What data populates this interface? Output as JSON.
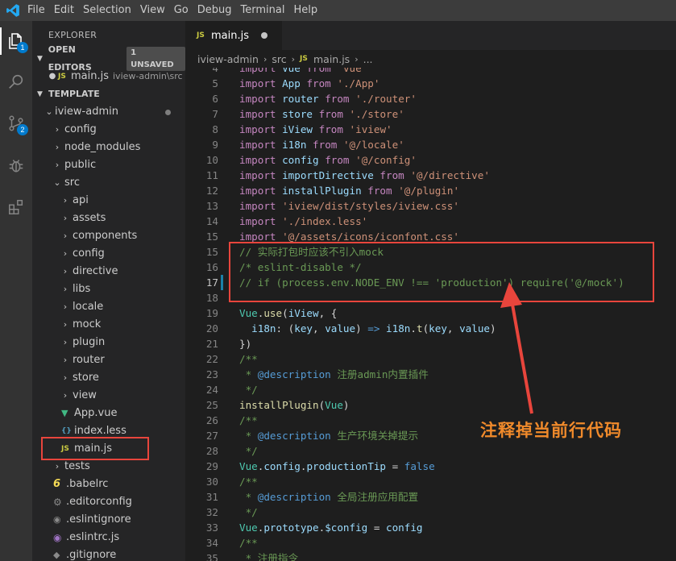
{
  "menubar": {
    "items": [
      "File",
      "Edit",
      "Selection",
      "View",
      "Go",
      "Debug",
      "Terminal",
      "Help"
    ]
  },
  "activitybar": {
    "explorer_badge": "1",
    "scm_badge": "2"
  },
  "sidebar": {
    "title": "EXPLORER",
    "open_editors": {
      "label": "OPEN EDITORS",
      "badge": "1 UNSAVED",
      "files": [
        {
          "name": "main.js",
          "path": "iview-admin\\src"
        }
      ]
    },
    "workspace": {
      "label": "TEMPLATE",
      "root": "iview-admin",
      "items": [
        {
          "name": "config",
          "type": "folder",
          "depth": 1
        },
        {
          "name": "node_modules",
          "type": "folder",
          "depth": 1
        },
        {
          "name": "public",
          "type": "folder",
          "depth": 1
        },
        {
          "name": "src",
          "type": "folder-open",
          "depth": 1
        },
        {
          "name": "api",
          "type": "folder",
          "depth": 2
        },
        {
          "name": "assets",
          "type": "folder",
          "depth": 2
        },
        {
          "name": "components",
          "type": "folder",
          "depth": 2
        },
        {
          "name": "config",
          "type": "folder",
          "depth": 2
        },
        {
          "name": "directive",
          "type": "folder",
          "depth": 2
        },
        {
          "name": "libs",
          "type": "folder",
          "depth": 2
        },
        {
          "name": "locale",
          "type": "folder",
          "depth": 2
        },
        {
          "name": "mock",
          "type": "folder",
          "depth": 2
        },
        {
          "name": "plugin",
          "type": "folder",
          "depth": 2
        },
        {
          "name": "router",
          "type": "folder",
          "depth": 2
        },
        {
          "name": "store",
          "type": "folder",
          "depth": 2
        },
        {
          "name": "view",
          "type": "folder",
          "depth": 2
        },
        {
          "name": "App.vue",
          "type": "vue",
          "depth": 2
        },
        {
          "name": "index.less",
          "type": "less",
          "depth": 2
        },
        {
          "name": "main.js",
          "type": "js",
          "depth": 2
        },
        {
          "name": "tests",
          "type": "folder",
          "depth": 1
        },
        {
          "name": ".babelrc",
          "type": "babel",
          "depth": 1
        },
        {
          "name": ".editorconfig",
          "type": "gear",
          "depth": 1
        },
        {
          "name": ".eslintignore",
          "type": "circle",
          "depth": 1
        },
        {
          "name": ".eslintrc.js",
          "type": "eslintrc",
          "depth": 1
        },
        {
          "name": ".gitignore",
          "type": "git",
          "depth": 1
        }
      ]
    }
  },
  "editor": {
    "tab_label": "main.js",
    "tab_icon": "JS",
    "breadcrumb": [
      "iview-admin",
      "src",
      "main.js",
      "..."
    ],
    "lines": [
      {
        "n": "4",
        "tokens": [
          [
            "kw",
            "import"
          ],
          [
            "plain",
            " "
          ],
          [
            "var",
            "Vue"
          ],
          [
            "plain",
            " "
          ],
          [
            "kw",
            "from"
          ],
          [
            "plain",
            " "
          ],
          [
            "str",
            "'vue'"
          ]
        ]
      },
      {
        "n": "5",
        "tokens": [
          [
            "kw",
            "import"
          ],
          [
            "plain",
            " "
          ],
          [
            "var",
            "App"
          ],
          [
            "plain",
            " "
          ],
          [
            "kw",
            "from"
          ],
          [
            "plain",
            " "
          ],
          [
            "str",
            "'./App'"
          ]
        ]
      },
      {
        "n": "6",
        "tokens": [
          [
            "kw",
            "import"
          ],
          [
            "plain",
            " "
          ],
          [
            "var",
            "router"
          ],
          [
            "plain",
            " "
          ],
          [
            "kw",
            "from"
          ],
          [
            "plain",
            " "
          ],
          [
            "str",
            "'./router'"
          ]
        ]
      },
      {
        "n": "7",
        "tokens": [
          [
            "kw",
            "import"
          ],
          [
            "plain",
            " "
          ],
          [
            "var",
            "store"
          ],
          [
            "plain",
            " "
          ],
          [
            "kw",
            "from"
          ],
          [
            "plain",
            " "
          ],
          [
            "str",
            "'./store'"
          ]
        ]
      },
      {
        "n": "8",
        "tokens": [
          [
            "kw",
            "import"
          ],
          [
            "plain",
            " "
          ],
          [
            "var",
            "iView"
          ],
          [
            "plain",
            " "
          ],
          [
            "kw",
            "from"
          ],
          [
            "plain",
            " "
          ],
          [
            "str",
            "'iview'"
          ]
        ]
      },
      {
        "n": "9",
        "tokens": [
          [
            "kw",
            "import"
          ],
          [
            "plain",
            " "
          ],
          [
            "var",
            "i18n"
          ],
          [
            "plain",
            " "
          ],
          [
            "kw",
            "from"
          ],
          [
            "plain",
            " "
          ],
          [
            "str",
            "'@/locale'"
          ]
        ]
      },
      {
        "n": "10",
        "tokens": [
          [
            "kw",
            "import"
          ],
          [
            "plain",
            " "
          ],
          [
            "var",
            "config"
          ],
          [
            "plain",
            " "
          ],
          [
            "kw",
            "from"
          ],
          [
            "plain",
            " "
          ],
          [
            "str",
            "'@/config'"
          ]
        ]
      },
      {
        "n": "11",
        "tokens": [
          [
            "kw",
            "import"
          ],
          [
            "plain",
            " "
          ],
          [
            "var",
            "importDirective"
          ],
          [
            "plain",
            " "
          ],
          [
            "kw",
            "from"
          ],
          [
            "plain",
            " "
          ],
          [
            "str",
            "'@/directive'"
          ]
        ]
      },
      {
        "n": "12",
        "tokens": [
          [
            "kw",
            "import"
          ],
          [
            "plain",
            " "
          ],
          [
            "var",
            "installPlugin"
          ],
          [
            "plain",
            " "
          ],
          [
            "kw",
            "from"
          ],
          [
            "plain",
            " "
          ],
          [
            "str",
            "'@/plugin'"
          ]
        ]
      },
      {
        "n": "13",
        "tokens": [
          [
            "kw",
            "import"
          ],
          [
            "plain",
            " "
          ],
          [
            "str",
            "'iview/dist/styles/iview.css'"
          ]
        ]
      },
      {
        "n": "14",
        "tokens": [
          [
            "kw",
            "import"
          ],
          [
            "plain",
            " "
          ],
          [
            "str",
            "'./index.less'"
          ]
        ]
      },
      {
        "n": "15",
        "tokens": [
          [
            "kw",
            "import"
          ],
          [
            "plain",
            " "
          ],
          [
            "str",
            "'@/assets/icons/iconfont.css'"
          ]
        ]
      },
      {
        "n": "15",
        "tokens": [
          [
            "cmt",
            "// 实际打包时应该不引入mock"
          ]
        ]
      },
      {
        "n": "16",
        "tokens": [
          [
            "cmt",
            "/* eslint-disable */"
          ]
        ]
      },
      {
        "n": "17",
        "tokens": [
          [
            "cmt",
            "// if (process.env.NODE_ENV !== 'production') require('@/mock')"
          ]
        ]
      },
      {
        "n": "18",
        "tokens": []
      },
      {
        "n": "19",
        "tokens": [
          [
            "cls",
            "Vue"
          ],
          [
            "plain",
            "."
          ],
          [
            "fn",
            "use"
          ],
          [
            "plain",
            "("
          ],
          [
            "var",
            "iView"
          ],
          [
            "plain",
            ", {"
          ]
        ]
      },
      {
        "n": "20",
        "tokens": [
          [
            "plain",
            "  "
          ],
          [
            "var",
            "i18n"
          ],
          [
            "plain",
            ": ("
          ],
          [
            "var",
            "key"
          ],
          [
            "plain",
            ", "
          ],
          [
            "var",
            "value"
          ],
          [
            "plain",
            ") "
          ],
          [
            "bool",
            "=>"
          ],
          [
            "plain",
            " "
          ],
          [
            "var",
            "i18n"
          ],
          [
            "plain",
            "."
          ],
          [
            "fn",
            "t"
          ],
          [
            "plain",
            "("
          ],
          [
            "var",
            "key"
          ],
          [
            "plain",
            ", "
          ],
          [
            "var",
            "value"
          ],
          [
            "plain",
            ")"
          ]
        ]
      },
      {
        "n": "21",
        "tokens": [
          [
            "plain",
            "})"
          ]
        ]
      },
      {
        "n": "22",
        "tokens": [
          [
            "cmt",
            "/**"
          ]
        ]
      },
      {
        "n": "23",
        "tokens": [
          [
            "cmt",
            " * "
          ],
          [
            "bool",
            "@description"
          ],
          [
            "cmt",
            " 注册admin内置插件"
          ]
        ]
      },
      {
        "n": "24",
        "tokens": [
          [
            "cmt",
            " */"
          ]
        ]
      },
      {
        "n": "25",
        "tokens": [
          [
            "fn",
            "installPlugin"
          ],
          [
            "plain",
            "("
          ],
          [
            "cls",
            "Vue"
          ],
          [
            "plain",
            ")"
          ]
        ]
      },
      {
        "n": "26",
        "tokens": [
          [
            "cmt",
            "/**"
          ]
        ]
      },
      {
        "n": "27",
        "tokens": [
          [
            "cmt",
            " * "
          ],
          [
            "bool",
            "@description"
          ],
          [
            "cmt",
            " 生产环境关掉提示"
          ]
        ]
      },
      {
        "n": "28",
        "tokens": [
          [
            "cmt",
            " */"
          ]
        ]
      },
      {
        "n": "29",
        "tokens": [
          [
            "cls",
            "Vue"
          ],
          [
            "plain",
            "."
          ],
          [
            "var",
            "config"
          ],
          [
            "plain",
            "."
          ],
          [
            "var",
            "productionTip"
          ],
          [
            "plain",
            " = "
          ],
          [
            "bool",
            "false"
          ]
        ]
      },
      {
        "n": "30",
        "tokens": [
          [
            "cmt",
            "/**"
          ]
        ]
      },
      {
        "n": "31",
        "tokens": [
          [
            "cmt",
            " * "
          ],
          [
            "bool",
            "@description"
          ],
          [
            "cmt",
            " 全局注册应用配置"
          ]
        ]
      },
      {
        "n": "32",
        "tokens": [
          [
            "cmt",
            " */"
          ]
        ]
      },
      {
        "n": "33",
        "tokens": [
          [
            "cls",
            "Vue"
          ],
          [
            "plain",
            "."
          ],
          [
            "var",
            "prototype"
          ],
          [
            "plain",
            "."
          ],
          [
            "var",
            "$config"
          ],
          [
            "plain",
            " = "
          ],
          [
            "var",
            "config"
          ]
        ]
      },
      {
        "n": "34",
        "tokens": [
          [
            "cmt",
            "/**"
          ]
        ]
      },
      {
        "n": "35",
        "tokens": [
          [
            "cmt",
            " * 注册指令"
          ]
        ]
      }
    ],
    "active_line": "17"
  },
  "annotation": {
    "text": "注释掉当前行代码"
  },
  "colors": {
    "annotation_red": "#e8453c",
    "annotation_orange": "#f08a2b",
    "accent": "#007acc"
  }
}
